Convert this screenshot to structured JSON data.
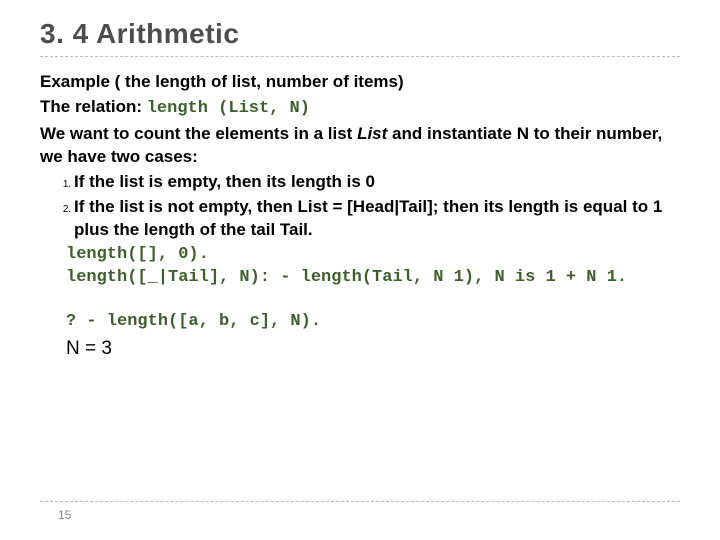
{
  "title": "3. 4 Arithmetic",
  "example_heading": "Example ( the length of list, number of items)",
  "relation_label": "The relation: ",
  "relation_code": "length (List, N)",
  "intro_part1": "We want to count the elements in a list ",
  "intro_list_word": "List",
  "intro_part2": " and instantiate N to their number, we have two cases:",
  "cases": [
    "If the list is empty, then its length is 0",
    "If the list is not empty, then List = [Head|Tail]; then its length is equal to 1 plus the length of the tail Tail."
  ],
  "code_lines": [
    "length([], 0).",
    "length([_|Tail], N): - length(Tail, N 1), N is 1 + N 1."
  ],
  "query": "? - length([a, b, c], N).",
  "result": "N = 3",
  "page_number": "15"
}
